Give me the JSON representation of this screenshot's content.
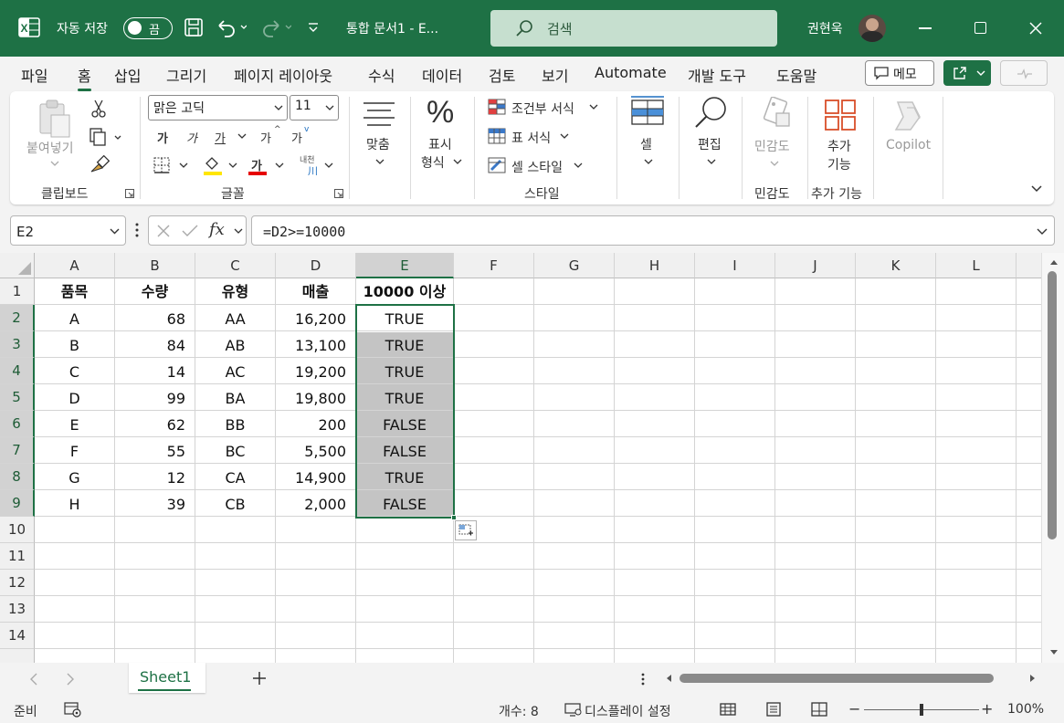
{
  "title_bar": {
    "autosave_label": "자동 저장",
    "autosave_state": "끔",
    "document_title": "통합 문서1  -  E...",
    "search_placeholder": "검색",
    "user_name": "권현욱",
    "brand_color": "#1e7145"
  },
  "menu": {
    "items": [
      "파일",
      "홈",
      "삽입",
      "그리기",
      "페이지 레이아웃",
      "수식",
      "데이터",
      "검토",
      "보기",
      "Automate",
      "개발 도구",
      "도움말"
    ],
    "active": "홈",
    "memo_label": "메모"
  },
  "ribbon": {
    "clipboard": {
      "paste": "붙여넣기",
      "group": "클립보드"
    },
    "font": {
      "name": "맑은 고딕",
      "size": "11",
      "group": "글꼴",
      "bold": "가",
      "italic": "가",
      "underline": "가",
      "grow": "가",
      "shrink": "가",
      "font_color": "가",
      "phonetic": "내천"
    },
    "alignment": {
      "label": "맞춤"
    },
    "number": {
      "label1": "표시",
      "label2": "형식"
    },
    "styles": {
      "conditional": "조건부 서식",
      "table": "표 서식",
      "cell_styles": "셀 스타일",
      "group": "스타일"
    },
    "cells": {
      "label": "셀"
    },
    "editing": {
      "label": "편집"
    },
    "sensitivity": {
      "label": "민감도",
      "group": "민감도"
    },
    "addins": {
      "label1": "추가",
      "label2": "기능",
      "group": "추가 기능"
    },
    "copilot": {
      "label": "Copilot"
    }
  },
  "formula_bar": {
    "name_box": "E2",
    "fx": "fx",
    "formula": "=D2>=10000"
  },
  "grid": {
    "columns": [
      "A",
      "B",
      "C",
      "D",
      "E",
      "F",
      "G",
      "H",
      "I",
      "J",
      "K",
      "L"
    ],
    "rows": [
      "1",
      "2",
      "3",
      "4",
      "5",
      "6",
      "7",
      "8",
      "9",
      "10",
      "11",
      "12",
      "13",
      "14"
    ],
    "headers": [
      "품목",
      "수량",
      "유형",
      "매출",
      "10000 이상"
    ],
    "data": [
      [
        "A",
        "68",
        "AA",
        "16,200",
        "TRUE"
      ],
      [
        "B",
        "84",
        "AB",
        "13,100",
        "TRUE"
      ],
      [
        "C",
        "14",
        "AC",
        "19,200",
        "TRUE"
      ],
      [
        "D",
        "99",
        "BA",
        "19,800",
        "TRUE"
      ],
      [
        "E",
        "62",
        "BB",
        "200",
        "FALSE"
      ],
      [
        "F",
        "55",
        "BC",
        "5,500",
        "FALSE"
      ],
      [
        "G",
        "12",
        "CA",
        "14,900",
        "TRUE"
      ],
      [
        "H",
        "39",
        "CB",
        "2,000",
        "FALSE"
      ]
    ],
    "selection": "E2:E9"
  },
  "sheets": {
    "tabs": [
      "Sheet1"
    ],
    "active": "Sheet1"
  },
  "status_bar": {
    "ready": "준비",
    "count": "개수: 8",
    "display_settings": "디스플레이 설정",
    "zoom": "100%"
  }
}
